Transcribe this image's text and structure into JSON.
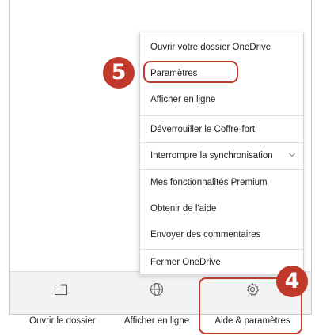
{
  "menu": {
    "items": [
      {
        "label": "Ouvrir votre dossier OneDrive"
      },
      {
        "label": "Paramètres"
      },
      {
        "label": "Afficher en ligne"
      },
      {
        "label": "Déverrouiller le Coffre-fort"
      },
      {
        "label": "Interrompre la synchronisation"
      },
      {
        "label": "Mes fonctionnalités Premium"
      },
      {
        "label": "Obtenir de l'aide"
      },
      {
        "label": "Envoyer des commentaires"
      },
      {
        "label": "Fermer OneDrive"
      }
    ]
  },
  "bottom_bar": {
    "open_folder": "Ouvrir le dossier",
    "view_online": "Afficher en ligne",
    "help_settings": "Aide & paramètres"
  },
  "callouts": {
    "step_settings": "5",
    "step_help": "4"
  },
  "colors": {
    "callout": "#c0392b"
  }
}
